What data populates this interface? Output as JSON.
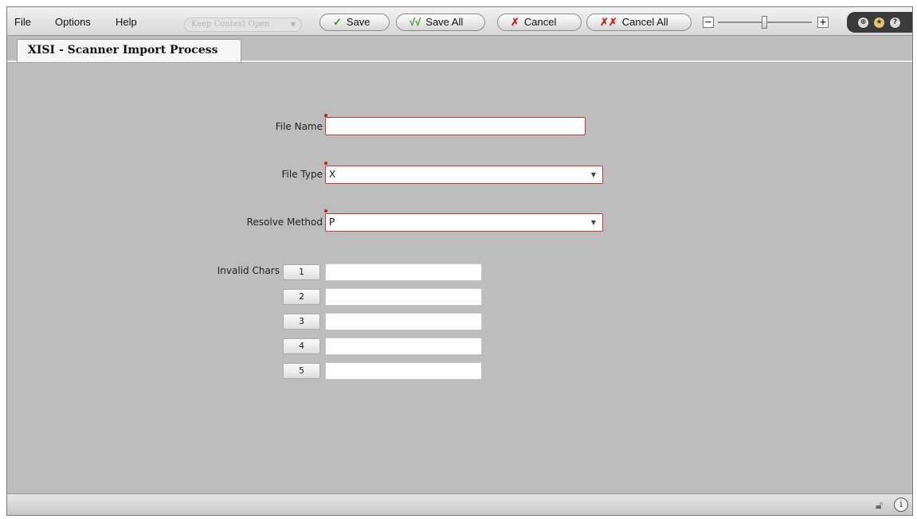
{
  "menu": {
    "file": "File",
    "options": "Options",
    "help": "Help"
  },
  "toolbar": {
    "keep_context": "Keep Context Open",
    "save": "Save",
    "save_all": "Save All",
    "cancel": "Cancel",
    "cancel_all": "Cancel All",
    "zoom_level": 0.5
  },
  "tab": {
    "title": "XISI - Scanner Import Process"
  },
  "form": {
    "file_name_label": "File Name",
    "file_name_value": "",
    "file_type_label": "File Type",
    "file_type_value": "X",
    "resolve_method_label": "Resolve Method",
    "resolve_method_value": "P",
    "invalid_chars_label": "Invalid Chars",
    "invalid_chars": [
      {
        "button": "1",
        "value": ""
      },
      {
        "button": "2",
        "value": ""
      },
      {
        "button": "3",
        "value": ""
      },
      {
        "button": "4",
        "value": ""
      },
      {
        "button": "5",
        "value": ""
      }
    ]
  },
  "icons": {
    "check": "✓",
    "double_check": "√√",
    "cross": "✗",
    "double_cross": "✗✗",
    "minus": "−",
    "plus": "+",
    "help": "?",
    "info": "i"
  },
  "colors": {
    "required": "#c02020",
    "check": "#3f8f2d",
    "cross": "#c82020"
  }
}
